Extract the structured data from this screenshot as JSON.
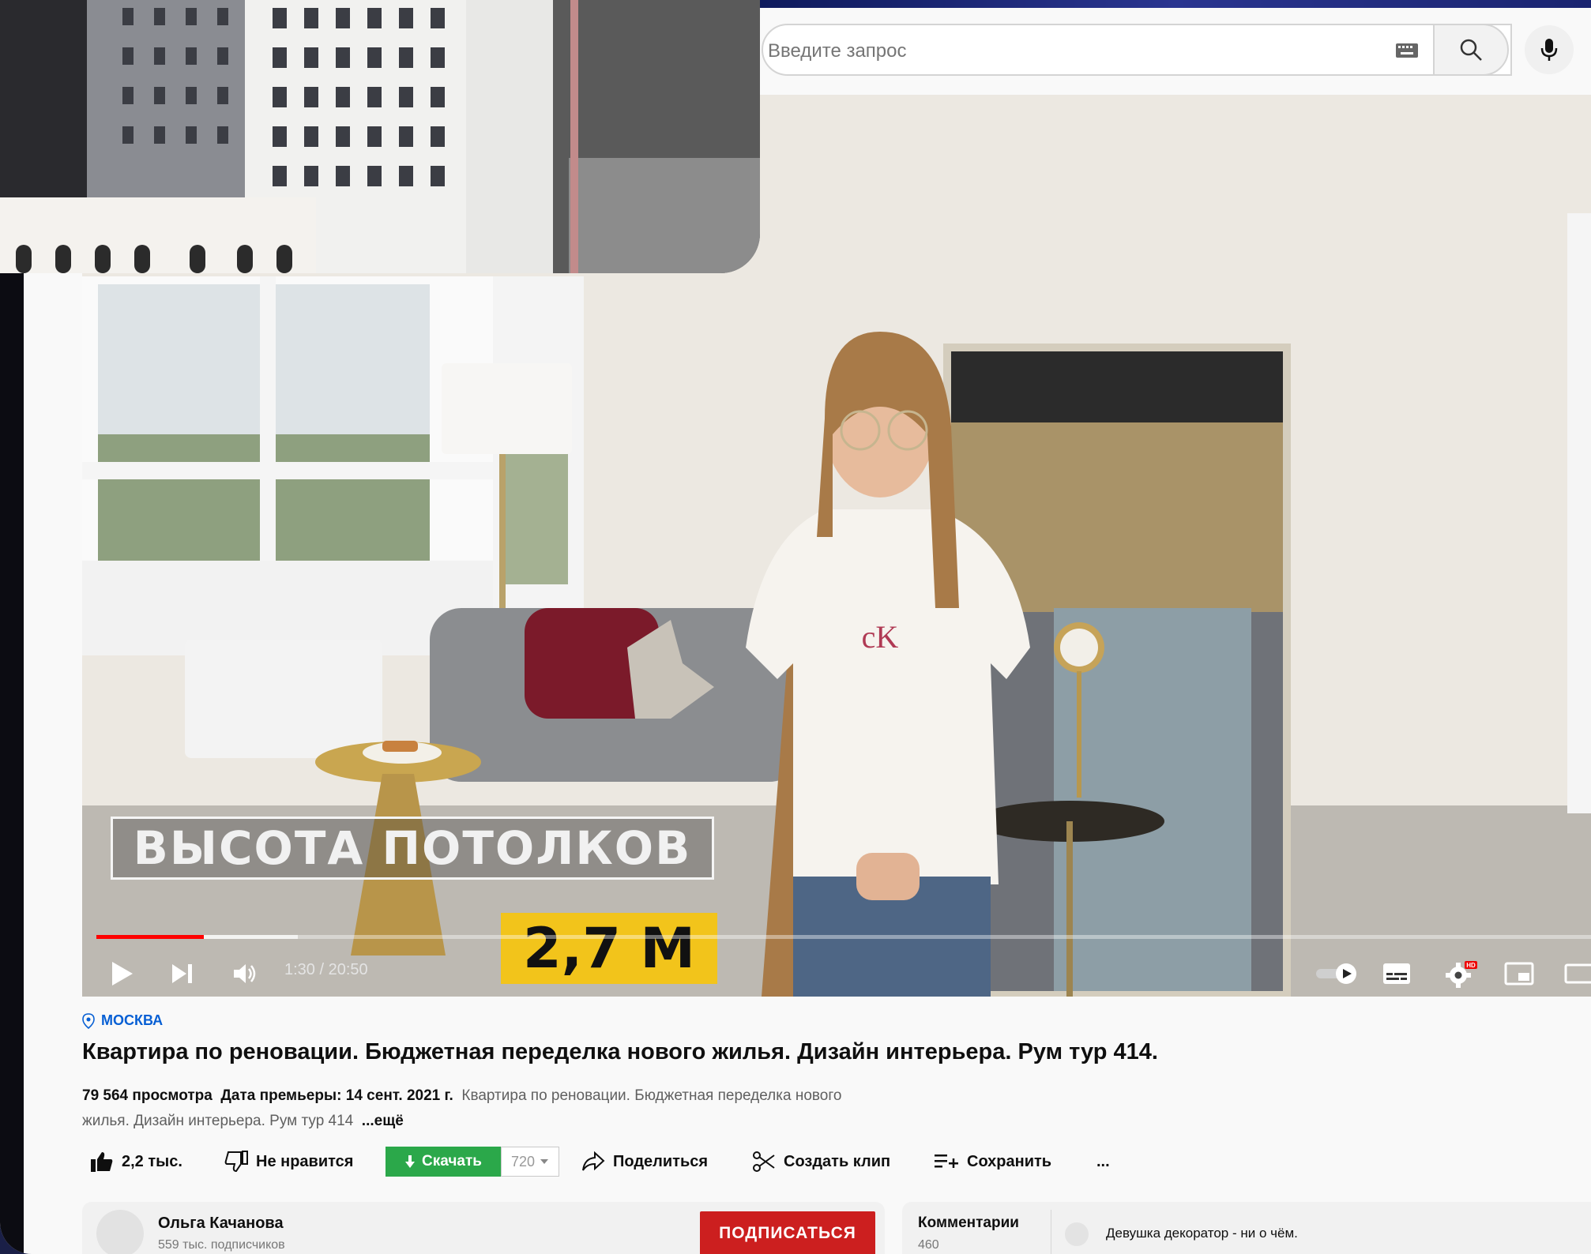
{
  "search": {
    "placeholder": "Введите запрос"
  },
  "video": {
    "caption_label": "ВЫСОТА ПОТОЛКОВ",
    "caption_value": "2,7 М",
    "time": "1:30 / 20:50",
    "progress_played": 0.072,
    "progress_buffered": 0.135,
    "hd_badge": "HD"
  },
  "location": "МОСКВА",
  "title": "Квартира по реновации. Бюджетная переделка нового жилья. Дизайн интерьера. Рум тур 414.",
  "meta": {
    "views": "79 564 просмотра",
    "premiere": "Дата премьеры: 14 сент. 2021 г.",
    "description_snippet": "Квартира по реновации. Бюджетная переделка нового жилья. Дизайн интерьера. Рум тур 414",
    "more": "...ещё"
  },
  "actions": {
    "likes": "2,2 тыс.",
    "dislike": "Не нравится",
    "download": "Скачать",
    "quality": "720",
    "share": "Поделиться",
    "clip": "Создать клип",
    "save": "Сохранить",
    "more": "..."
  },
  "channel": {
    "name": "Ольга Качанова",
    "subscribers": "559 тыс. подписчиков",
    "subscribe": "ПОДПИСАТЬСЯ"
  },
  "comments": {
    "title": "Комментарии",
    "count": "460",
    "top_comment": "Девушка декоратор - ни о чём."
  },
  "colors": {
    "accent_red": "#ff0000",
    "subscribe_red": "#cc1f1f",
    "download_green": "#2ba84a",
    "caption_yellow": "#f2c41b",
    "link_blue": "#065fd4"
  }
}
